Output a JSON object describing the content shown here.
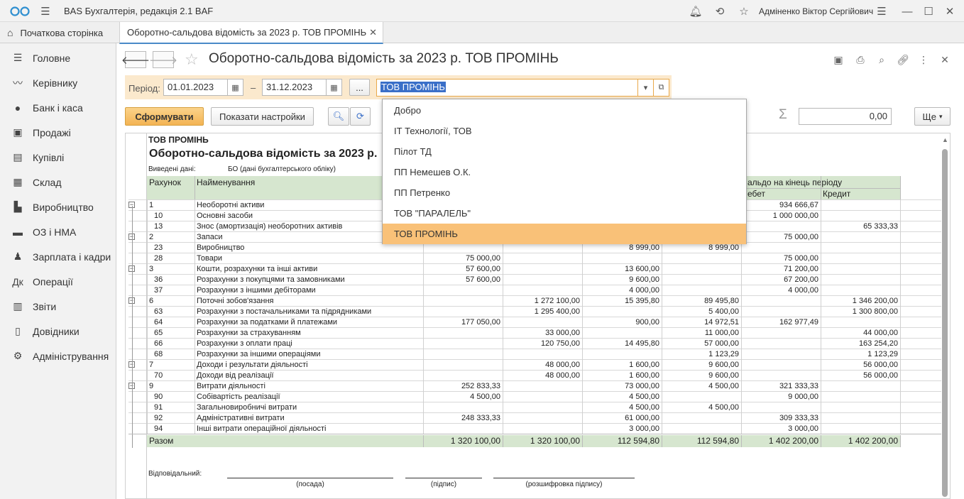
{
  "app": {
    "title": "BAS Бухгалтерія, редакція 2.1 BAF",
    "user": "Адміненко Віктор Сергійович"
  },
  "tabs": {
    "home": "Початкова сторінка",
    "report": "Оборотно-сальдова відомість за 2023 р. ТОВ ПРОМІНЬ"
  },
  "sidebar": {
    "items": [
      {
        "label": "Головне",
        "icon": "menu-icon"
      },
      {
        "label": "Керівнику",
        "icon": "chart-line-icon"
      },
      {
        "label": "Банк і каса",
        "icon": "coin-icon"
      },
      {
        "label": "Продажі",
        "icon": "shopping-bag-icon"
      },
      {
        "label": "Купівлі",
        "icon": "cart-icon"
      },
      {
        "label": "Склад",
        "icon": "warehouse-icon"
      },
      {
        "label": "Виробництво",
        "icon": "factory-icon"
      },
      {
        "label": "ОЗ і НМА",
        "icon": "truck-icon"
      },
      {
        "label": "Зарплата і кадри",
        "icon": "person-icon"
      },
      {
        "label": "Операції",
        "icon": "ledger-icon"
      },
      {
        "label": "Звіти",
        "icon": "bar-chart-icon"
      },
      {
        "label": "Довідники",
        "icon": "book-icon"
      },
      {
        "label": "Адміністрування",
        "icon": "gear-icon"
      }
    ]
  },
  "header": {
    "title": "Оборотно-сальдова відомість за 2023 р. ТОВ ПРОМІНЬ"
  },
  "period": {
    "label": "Період:",
    "from": "01.01.2023",
    "dash": "–",
    "to": "31.12.2023",
    "more": "...",
    "org": "ТОВ ПРОМІНЬ"
  },
  "toolbar": {
    "form": "Сформувати",
    "settings": "Показати настройки",
    "sum": "0,00",
    "more": "Ще"
  },
  "dropdown": {
    "items": [
      "Добро",
      "ІТ Технології, ТОВ",
      "Пілот ТД",
      "ПП Немешев О.К.",
      "ПП Петренко",
      "ТОВ \"ПАРАЛЕЛЬ\"",
      "ТОВ ПРОМІНЬ"
    ],
    "selected": 6
  },
  "report": {
    "org": "ТОВ ПРОМІНЬ",
    "title": "Оборотно-сальдова відомість за 2023 р.",
    "data_label": "Виведені дані:",
    "data_value": "БО (дані бухгалтерського обліку)",
    "col_account": "Рахунок",
    "col_name": "Найменування",
    "col_end_balance": "альдо на кінець періоду",
    "col_debit": "ебет",
    "col_credit": "Кредит",
    "rows": [
      {
        "acc": "1",
        "name": "Необоротні активи",
        "v": [
          "",
          "",
          "",
          "",
          "934 666,67",
          ""
        ],
        "group": true
      },
      {
        "acc": "10",
        "name": "Основні засоби",
        "v": [
          "",
          "",
          "",
          "",
          "1 000 000,00",
          ""
        ]
      },
      {
        "acc": "13",
        "name": "Знос (амортизація) необоротних активів",
        "v": [
          "",
          "",
          "",
          "",
          "",
          "65 333,33"
        ]
      },
      {
        "acc": "2",
        "name": "Запаси",
        "v": [
          "",
          "",
          "",
          "",
          "75 000,00",
          ""
        ],
        "group": true
      },
      {
        "acc": "23",
        "name": "Виробництво",
        "v": [
          "",
          "",
          "8 999,00",
          "8 999,00",
          "",
          ""
        ]
      },
      {
        "acc": "28",
        "name": "Товари",
        "v": [
          "75 000,00",
          "",
          "",
          "",
          "75 000,00",
          ""
        ]
      },
      {
        "acc": "3",
        "name": "Кошти, розрахунки та інші активи",
        "v": [
          "57 600,00",
          "",
          "13 600,00",
          "",
          "71 200,00",
          ""
        ],
        "group": true
      },
      {
        "acc": "36",
        "name": "Розрахунки з покупцями та замовниками",
        "v": [
          "57 600,00",
          "",
          "9 600,00",
          "",
          "67 200,00",
          ""
        ]
      },
      {
        "acc": "37",
        "name": "Розрахунки з іншими дебіторами",
        "v": [
          "",
          "",
          "4 000,00",
          "",
          "4 000,00",
          ""
        ]
      },
      {
        "acc": "6",
        "name": "Поточні зобов'язання",
        "v": [
          "",
          "1 272 100,00",
          "15 395,80",
          "89 495,80",
          "",
          "1 346 200,00"
        ],
        "group": true
      },
      {
        "acc": "63",
        "name": "Розрахунки з постачальниками та підрядниками",
        "v": [
          "",
          "1 295 400,00",
          "",
          "5 400,00",
          "",
          "1 300 800,00"
        ]
      },
      {
        "acc": "64",
        "name": "Розрахунки за податками й платежами",
        "v": [
          "177 050,00",
          "",
          "900,00",
          "14 972,51",
          "162 977,49",
          ""
        ]
      },
      {
        "acc": "65",
        "name": "Розрахунки за страхуванням",
        "v": [
          "",
          "33 000,00",
          "",
          "11 000,00",
          "",
          "44 000,00"
        ]
      },
      {
        "acc": "66",
        "name": "Розрахунки з оплати праці",
        "v": [
          "",
          "120 750,00",
          "14 495,80",
          "57 000,00",
          "",
          "163 254,20"
        ]
      },
      {
        "acc": "68",
        "name": "Розрахунки за іншими операціями",
        "v": [
          "",
          "",
          "",
          "1 123,29",
          "",
          "1 123,29"
        ]
      },
      {
        "acc": "7",
        "name": "Доходи і результати діяльності",
        "v": [
          "",
          "48 000,00",
          "1 600,00",
          "9 600,00",
          "",
          "56 000,00"
        ],
        "group": true
      },
      {
        "acc": "70",
        "name": "Доходи від реалізації",
        "v": [
          "",
          "48 000,00",
          "1 600,00",
          "9 600,00",
          "",
          "56 000,00"
        ]
      },
      {
        "acc": "9",
        "name": "Витрати діяльності",
        "v": [
          "252 833,33",
          "",
          "73 000,00",
          "4 500,00",
          "321 333,33",
          ""
        ],
        "group": true
      },
      {
        "acc": "90",
        "name": "Собівартість реалізації",
        "v": [
          "4 500,00",
          "",
          "4 500,00",
          "",
          "9 000,00",
          ""
        ]
      },
      {
        "acc": "91",
        "name": "Загальновиробничі витрати",
        "v": [
          "",
          "",
          "4 500,00",
          "4 500,00",
          "",
          ""
        ]
      },
      {
        "acc": "92",
        "name": "Адміністративні витрати",
        "v": [
          "248 333,33",
          "",
          "61 000,00",
          "",
          "309 333,33",
          ""
        ]
      },
      {
        "acc": "94",
        "name": "Інші витрати операційної діяльності",
        "v": [
          "",
          "",
          "3 000,00",
          "",
          "3 000,00",
          ""
        ]
      }
    ],
    "total": {
      "label": "Разом",
      "v": [
        "1 320 100,00",
        "1 320 100,00",
        "112 594,80",
        "112 594,80",
        "1 402 200,00",
        "1 402 200,00"
      ]
    },
    "responsible": "Відповідальний:",
    "sig_position": "(посада)",
    "sig_sign": "(підпис)",
    "sig_name": "(розшифровка підпису)"
  }
}
